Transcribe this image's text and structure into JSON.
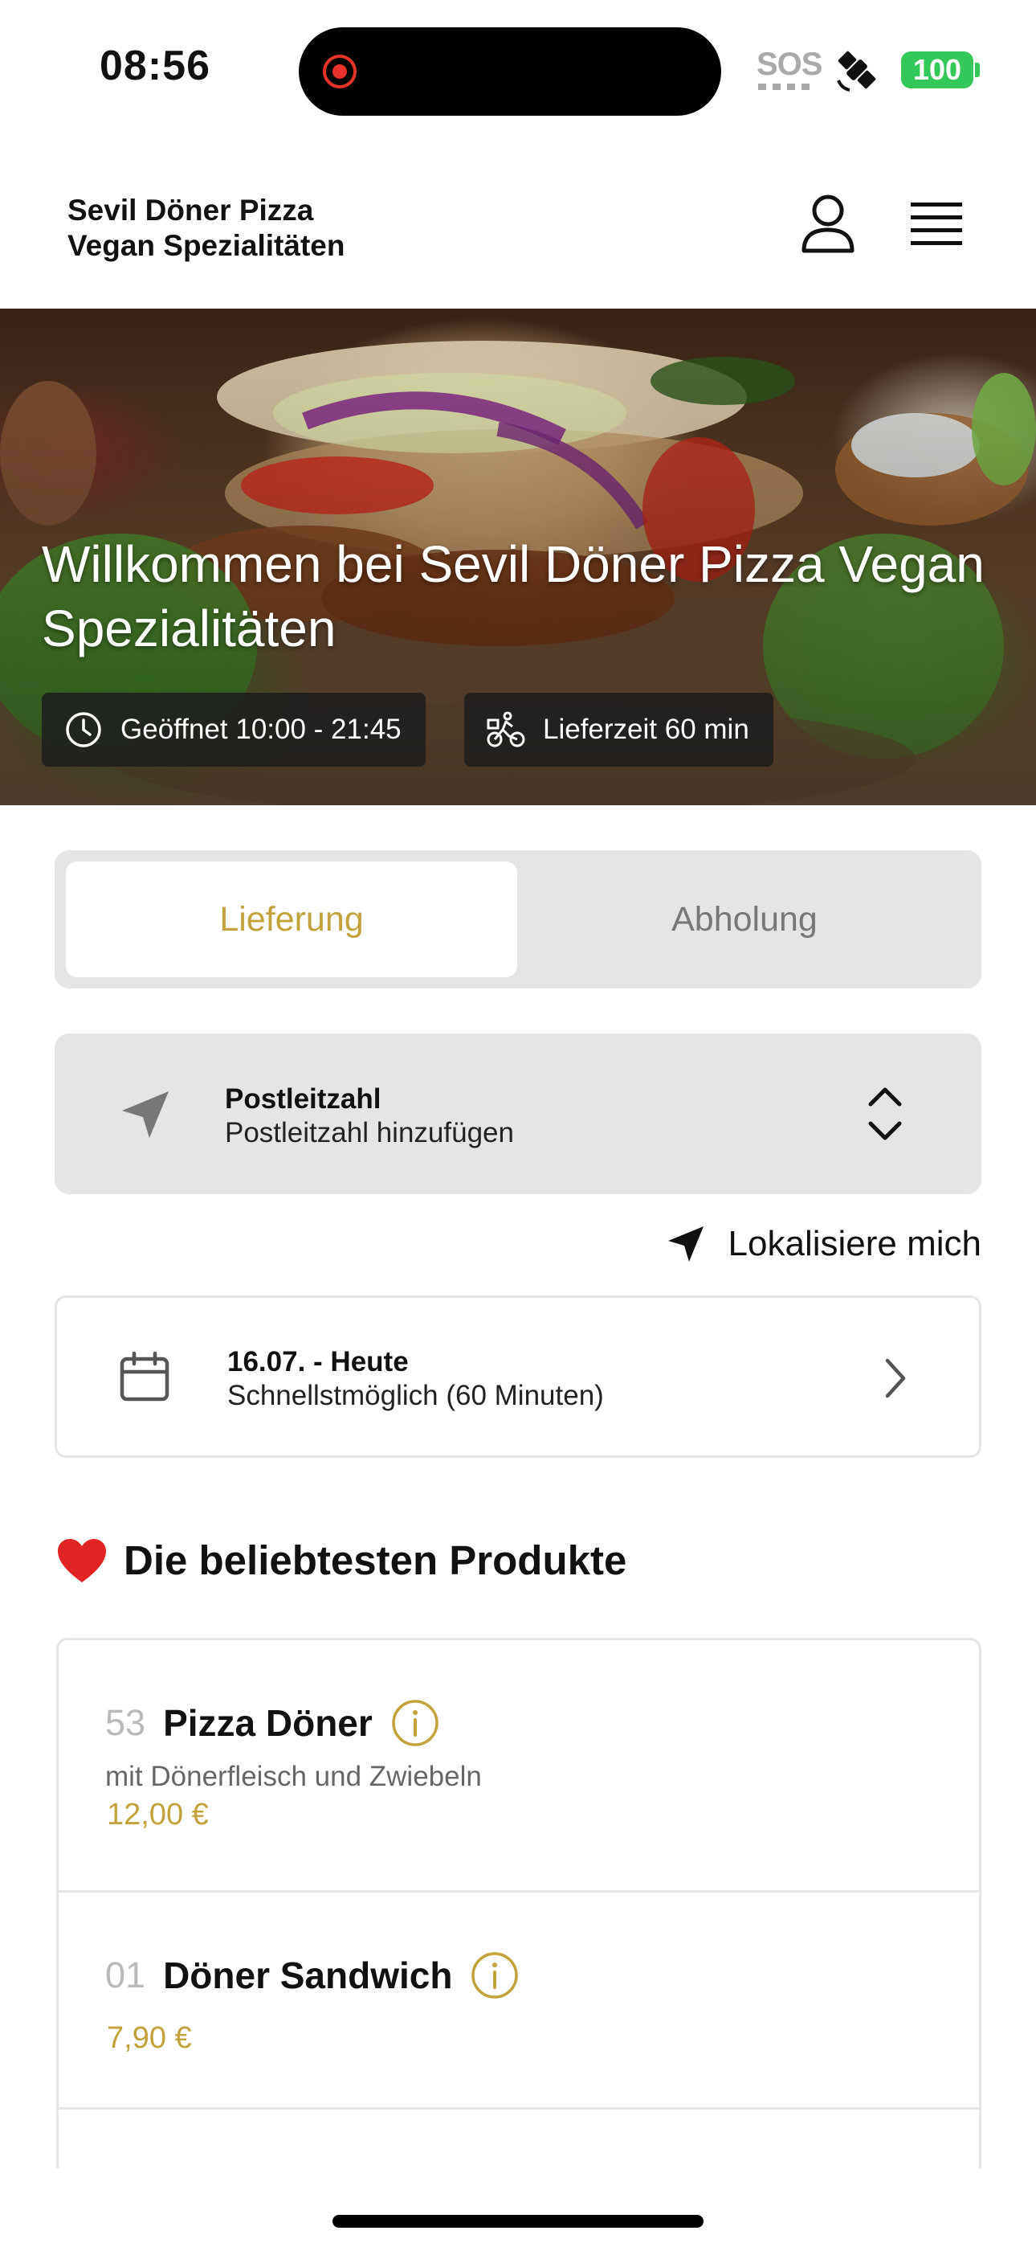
{
  "status_bar": {
    "time": "08:56",
    "sos": "SOS",
    "battery": "100",
    "icons": [
      "screen-record-icon",
      "satellite-icon"
    ]
  },
  "header": {
    "brand_line1": "Sevil Döner Pizza",
    "brand_line2": "Vegan Spezialitäten",
    "icons": [
      "user-icon",
      "menu-icon"
    ]
  },
  "hero": {
    "title": "Willkommen bei Sevil Döner Pizza Vegan Spezialitäten",
    "opening_hours": "Geöffnet 10:00 - 21:45",
    "delivery_time": "Lieferzeit 60 min"
  },
  "mode_toggle": {
    "delivery": "Lieferung",
    "pickup": "Abholung",
    "selected": "Lieferung"
  },
  "postcode": {
    "label": "Postleitzahl",
    "placeholder": "Postleitzahl hinzufügen"
  },
  "locate": {
    "label": "Lokalisiere mich"
  },
  "date": {
    "title": "16.07. - Heute",
    "subtitle": "Schnellstmöglich (60 Minuten)"
  },
  "popular": {
    "title": "Die beliebtesten Produkte",
    "products": [
      {
        "number": "53",
        "name": "Pizza Döner",
        "description": "mit Dönerfleisch und Zwiebeln",
        "price": "12,00 €"
      },
      {
        "number": "01",
        "name": "Döner Sandwich",
        "price": "7,90 €"
      }
    ]
  },
  "colors": {
    "accent": "#c2a23d",
    "card_bg": "#e5e5e5",
    "battery": "#34c759",
    "recording": "#e5332a",
    "heart": "#e02424"
  }
}
